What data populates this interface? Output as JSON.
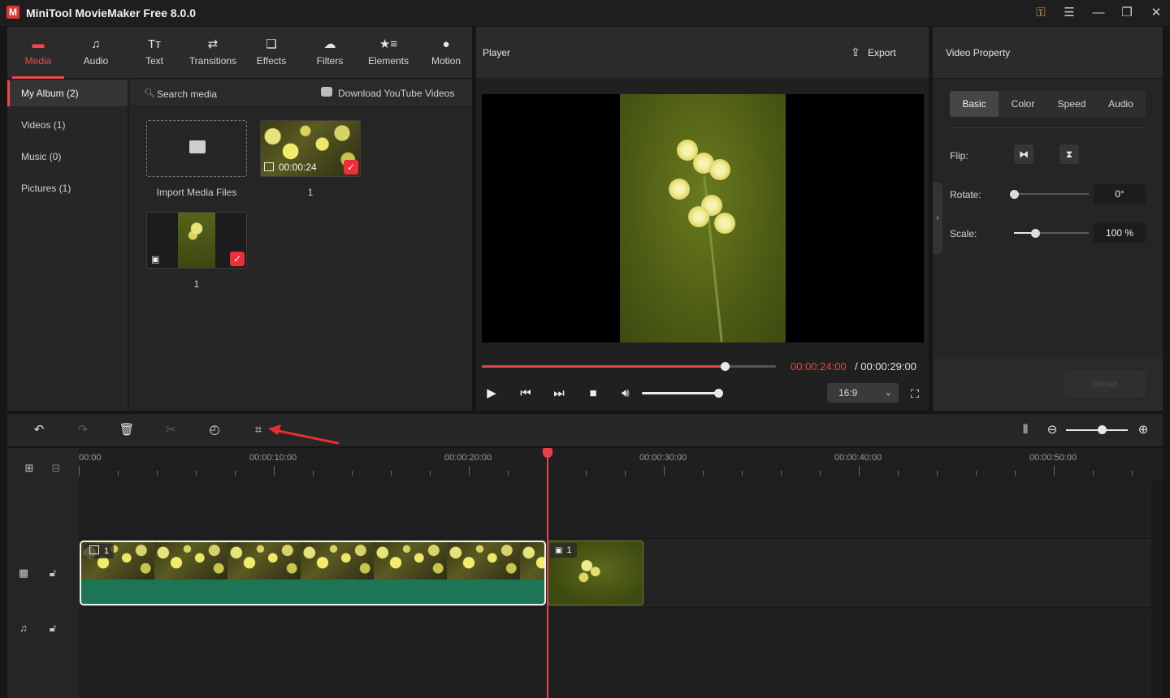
{
  "app": {
    "title": "MiniTool MovieMaker Free 8.0.0",
    "logo_letter": "M"
  },
  "titlebar_icons": [
    "key-icon",
    "hamburger-menu-icon",
    "minimize-icon",
    "maximize-icon",
    "close-icon"
  ],
  "media_tabs": [
    {
      "label": "Media",
      "icon": "media-folder-icon",
      "active": true
    },
    {
      "label": "Audio",
      "icon": "music-note-icon"
    },
    {
      "label": "Text",
      "icon": "text-icon"
    },
    {
      "label": "Transitions",
      "icon": "transitions-icon"
    },
    {
      "label": "Effects",
      "icon": "effects-icon"
    },
    {
      "label": "Filters",
      "icon": "filters-icon"
    },
    {
      "label": "Elements",
      "icon": "elements-icon"
    },
    {
      "label": "Motion",
      "icon": "motion-icon"
    }
  ],
  "albums": [
    {
      "label": "My Album (2)",
      "active": true
    },
    {
      "label": "Videos (1)"
    },
    {
      "label": "Music (0)"
    },
    {
      "label": "Pictures (1)"
    }
  ],
  "media_toolbar": {
    "search_label": "Search media",
    "youtube_label": "Download YouTube Videos"
  },
  "media_items": [
    {
      "label": "Import Media Files",
      "kind": "import"
    },
    {
      "label": "1",
      "kind": "video",
      "duration": "00:00:24",
      "checked": true
    },
    {
      "label": "1",
      "kind": "image",
      "checked": true
    }
  ],
  "player": {
    "title": "Player",
    "export_label": "Export",
    "time_current": "00:00:24:00",
    "time_total": "/ 00:00:29:00",
    "progress_fraction": 0.827,
    "volume_fraction": 1.0,
    "aspect_ratio": "16:9",
    "accent": "#e0474b"
  },
  "property": {
    "title": "Video Property",
    "tabs": [
      {
        "label": "Basic",
        "active": true
      },
      {
        "label": "Color"
      },
      {
        "label": "Speed"
      },
      {
        "label": "Audio"
      }
    ],
    "flip_label": "Flip:",
    "rotate_label": "Rotate:",
    "rotate_value": "0°",
    "rotate_fraction": 0.0,
    "scale_label": "Scale:",
    "scale_value": "100 %",
    "scale_fraction": 0.28,
    "reset_label": "Reset"
  },
  "timeline_tools": [
    "undo-icon",
    "redo-icon",
    "delete-icon",
    "split-icon",
    "speed-icon",
    "crop-icon"
  ],
  "timeline": {
    "ruler_labels": [
      "00:00",
      "00:00:10:00",
      "00:00:20:00",
      "00:00:30:00",
      "00:00:40:00",
      "00:00:50:00"
    ],
    "zoom_fraction": 0.58,
    "video_clip_label": "1",
    "image_clip_label": "1",
    "playhead_time": "00:00:24:00"
  }
}
